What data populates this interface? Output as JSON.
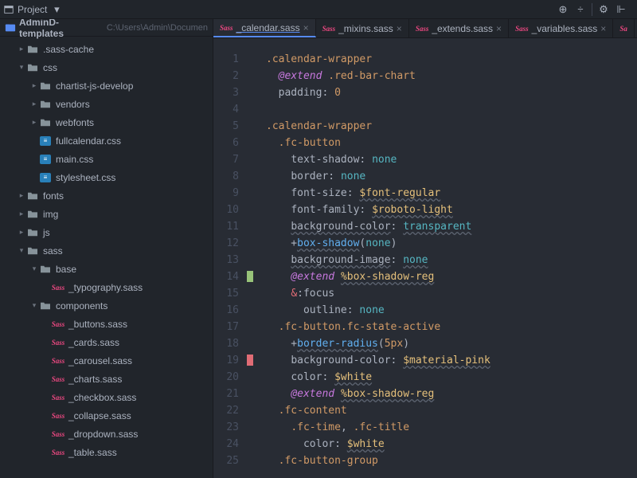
{
  "topbar": {
    "label": "Project",
    "dropdown_icon": "chevron-down"
  },
  "project": {
    "name": "AdminD-templates",
    "path": "C:\\Users\\Admin\\Documen"
  },
  "tree": [
    {
      "label": ".sass-cache",
      "type": "folder",
      "open": false,
      "indent": 1,
      "chev": "right"
    },
    {
      "label": "css",
      "type": "folder",
      "open": true,
      "indent": 1,
      "chev": "down"
    },
    {
      "label": "chartist-js-develop",
      "type": "folder",
      "open": false,
      "indent": 2,
      "chev": "right"
    },
    {
      "label": "vendors",
      "type": "folder",
      "open": false,
      "indent": 2,
      "chev": "right"
    },
    {
      "label": "webfonts",
      "type": "folder",
      "open": false,
      "indent": 2,
      "chev": "right"
    },
    {
      "label": "fullcalendar.css",
      "type": "css",
      "indent": 2
    },
    {
      "label": "main.css",
      "type": "css",
      "indent": 2
    },
    {
      "label": "stylesheet.css",
      "type": "css",
      "indent": 2
    },
    {
      "label": "fonts",
      "type": "folder",
      "open": false,
      "indent": 1,
      "chev": "right"
    },
    {
      "label": "img",
      "type": "folder",
      "open": false,
      "indent": 1,
      "chev": "right"
    },
    {
      "label": "js",
      "type": "folder",
      "open": false,
      "indent": 1,
      "chev": "right"
    },
    {
      "label": "sass",
      "type": "folder",
      "open": true,
      "indent": 1,
      "chev": "down"
    },
    {
      "label": "base",
      "type": "folder",
      "open": true,
      "indent": 2,
      "chev": "down"
    },
    {
      "label": "_typography.sass",
      "type": "sass",
      "indent": 3
    },
    {
      "label": "components",
      "type": "folder",
      "open": true,
      "indent": 2,
      "chev": "down"
    },
    {
      "label": "_buttons.sass",
      "type": "sass",
      "indent": 3
    },
    {
      "label": "_cards.sass",
      "type": "sass",
      "indent": 3
    },
    {
      "label": "_carousel.sass",
      "type": "sass",
      "indent": 3
    },
    {
      "label": "_charts.sass",
      "type": "sass",
      "indent": 3
    },
    {
      "label": "_checkbox.sass",
      "type": "sass",
      "indent": 3
    },
    {
      "label": "_collapse.sass",
      "type": "sass",
      "indent": 3
    },
    {
      "label": "_dropdown.sass",
      "type": "sass",
      "indent": 3
    },
    {
      "label": "_table.sass",
      "type": "sass",
      "indent": 3
    }
  ],
  "tabs": [
    {
      "label": "_calendar.sass",
      "active": true
    },
    {
      "label": "_mixins.sass",
      "active": false
    },
    {
      "label": "_extends.sass",
      "active": false
    },
    {
      "label": "_variables.sass",
      "active": false
    }
  ],
  "code": {
    "first_line": 1,
    "last_line": 25,
    "lines": [
      {
        "n": 1,
        "tokens": [
          [
            "",
            ".calendar-wrapper",
            "sel"
          ]
        ]
      },
      {
        "n": 2,
        "tokens": [
          [
            "  ",
            "@extend",
            "kw"
          ],
          [
            " ",
            ".red-bar-chart",
            "sel"
          ]
        ]
      },
      {
        "n": 3,
        "tokens": [
          [
            "  ",
            "padding",
            "prop"
          ],
          [
            ": ",
            "",
            "punc"
          ],
          [
            "",
            "0",
            "num"
          ]
        ]
      },
      {
        "n": 4,
        "tokens": []
      },
      {
        "n": 5,
        "tokens": [
          [
            "",
            ".calendar-wrapper",
            "sel"
          ]
        ]
      },
      {
        "n": 6,
        "tokens": [
          [
            "  ",
            ".fc-button",
            "sel"
          ]
        ]
      },
      {
        "n": 7,
        "tokens": [
          [
            "    ",
            "text-shadow",
            "prop"
          ],
          [
            ": ",
            "",
            "punc"
          ],
          [
            "",
            "none",
            "val"
          ]
        ]
      },
      {
        "n": 8,
        "tokens": [
          [
            "    ",
            "border",
            "prop"
          ],
          [
            ": ",
            "",
            "punc"
          ],
          [
            "",
            "none",
            "val"
          ]
        ]
      },
      {
        "n": 9,
        "tokens": [
          [
            "    ",
            "font-size",
            "prop"
          ],
          [
            ": ",
            "",
            "punc"
          ],
          [
            "",
            "$font-regular",
            "var",
            true
          ]
        ]
      },
      {
        "n": 10,
        "tokens": [
          [
            "    ",
            "font-family",
            "prop"
          ],
          [
            ": ",
            "",
            "punc"
          ],
          [
            "",
            "$roboto-light",
            "var",
            true
          ]
        ]
      },
      {
        "n": 11,
        "tokens": [
          [
            "    ",
            "background-color",
            "prop",
            true
          ],
          [
            ": ",
            "",
            "punc"
          ],
          [
            "",
            "transparent",
            "val",
            true
          ]
        ]
      },
      {
        "n": 12,
        "tokens": [
          [
            "    +",
            "",
            "punc"
          ],
          [
            "",
            "box-shadow",
            "mixin",
            true
          ],
          [
            "(",
            "",
            "punc"
          ],
          [
            "",
            "none",
            "val"
          ],
          [
            ")",
            "",
            "punc"
          ]
        ]
      },
      {
        "n": 13,
        "tokens": [
          [
            "    ",
            "background-image",
            "prop",
            true
          ],
          [
            ": ",
            "",
            "punc"
          ],
          [
            "",
            "none",
            "val",
            true
          ]
        ]
      },
      {
        "n": 14,
        "tokens": [
          [
            "    ",
            "@extend",
            "kw"
          ],
          [
            " ",
            "%box-shadow-reg",
            "ext",
            true
          ]
        ]
      },
      {
        "n": 15,
        "tokens": [
          [
            "    ",
            "&",
            "red"
          ],
          [
            ":",
            "",
            "punc"
          ],
          [
            "",
            "focus",
            "text"
          ]
        ]
      },
      {
        "n": 16,
        "tokens": [
          [
            "      ",
            "outline",
            "prop"
          ],
          [
            ": ",
            "",
            "punc"
          ],
          [
            "",
            "none",
            "val"
          ]
        ]
      },
      {
        "n": 17,
        "tokens": [
          [
            "  ",
            ".fc-button.fc-state-active",
            "sel"
          ]
        ]
      },
      {
        "n": 18,
        "tokens": [
          [
            "    +",
            "",
            "punc"
          ],
          [
            "",
            "border-radius",
            "mixin",
            true
          ],
          [
            "(",
            "",
            "punc"
          ],
          [
            "",
            "5px",
            "num"
          ],
          [
            ")",
            "",
            "punc"
          ]
        ]
      },
      {
        "n": 19,
        "tokens": [
          [
            "    ",
            "background-color",
            "prop"
          ],
          [
            ": ",
            "",
            "punc"
          ],
          [
            "",
            "$material-pink",
            "var",
            true
          ]
        ]
      },
      {
        "n": 20,
        "tokens": [
          [
            "    ",
            "color",
            "prop"
          ],
          [
            ": ",
            "",
            "punc"
          ],
          [
            "",
            "$white",
            "var",
            true
          ]
        ]
      },
      {
        "n": 21,
        "tokens": [
          [
            "    ",
            "@extend",
            "kw"
          ],
          [
            " ",
            "%box-shadow-reg",
            "ext",
            true
          ]
        ]
      },
      {
        "n": 22,
        "tokens": [
          [
            "  ",
            ".fc-content",
            "sel"
          ]
        ]
      },
      {
        "n": 23,
        "tokens": [
          [
            "    ",
            ".fc-time",
            "sel"
          ],
          [
            ", ",
            "",
            "punc"
          ],
          [
            "",
            ".fc-title",
            "sel"
          ]
        ]
      },
      {
        "n": 24,
        "tokens": [
          [
            "      ",
            "color",
            "prop"
          ],
          [
            ": ",
            "",
            "punc"
          ],
          [
            "",
            "$white",
            "var",
            true
          ]
        ]
      },
      {
        "n": 25,
        "tokens": [
          [
            "  ",
            ".fc-button-group",
            "sel"
          ]
        ]
      }
    ],
    "marks": [
      {
        "line": 14,
        "color": "green"
      },
      {
        "line": 19,
        "color": "pink"
      }
    ]
  }
}
